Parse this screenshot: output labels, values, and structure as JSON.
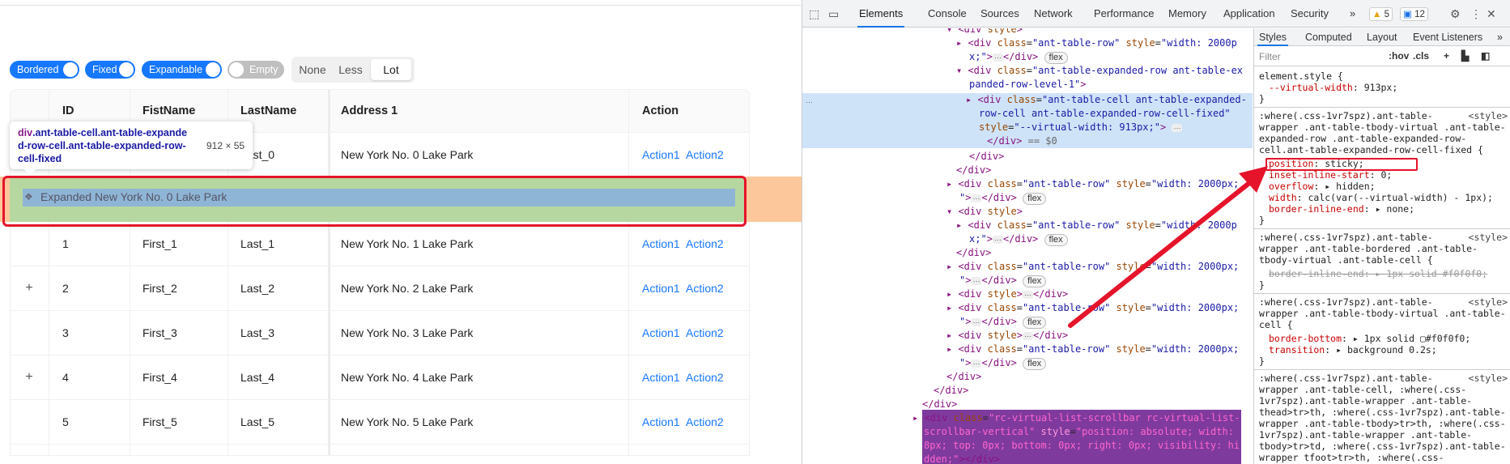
{
  "page": {
    "switches": [
      {
        "label": "Bordered",
        "on": true
      },
      {
        "label": "Fixed",
        "on": true
      },
      {
        "label": "Expandable",
        "on": true
      },
      {
        "label": "Empty",
        "on": false
      }
    ],
    "density": {
      "options": [
        "None",
        "Less",
        "Lot"
      ],
      "selected": "Lot"
    },
    "table": {
      "columns": [
        "ID",
        "FistName",
        "LastName",
        "Address 1",
        "Action"
      ],
      "rows": [
        {
          "expand": "",
          "id": "",
          "first": "",
          "last": "Last_0",
          "addr": "New York No. 0 Lake Park",
          "a1": "Action1",
          "a2": "Action2"
        },
        {
          "expand": "",
          "id": "1",
          "first": "First_1",
          "last": "Last_1",
          "addr": "New York No. 1 Lake Park",
          "a1": "Action1",
          "a2": "Action2"
        },
        {
          "expand": "+",
          "id": "2",
          "first": "First_2",
          "last": "Last_2",
          "addr": "New York No. 2 Lake Park",
          "a1": "Action1",
          "a2": "Action2"
        },
        {
          "expand": "",
          "id": "3",
          "first": "First_3",
          "last": "Last_3",
          "addr": "New York No. 3 Lake Park",
          "a1": "Action1",
          "a2": "Action2"
        },
        {
          "expand": "+",
          "id": "4",
          "first": "First_4",
          "last": "Last_4",
          "addr": "New York No. 4 Lake Park",
          "a1": "Action1",
          "a2": "Action2"
        },
        {
          "expand": "",
          "id": "5",
          "first": "First_5",
          "last": "Last_5",
          "addr": "New York No. 5 Lake Park",
          "a1": "Action1",
          "a2": "Action2"
        }
      ],
      "expanded_text": "Expanded New York No. 0 Lake Park"
    },
    "tooltip": {
      "tag": "div",
      "classes": ".ant-table-cell.ant-table-expanded-row-cell.ant-table-expanded-row-cell-fixed",
      "line1": ".ant-table-cell.ant-table-expande",
      "line2": "d-row-cell.ant-table-expanded-row-",
      "line3": "cell-fixed",
      "size": "912 × 55"
    }
  },
  "devtools": {
    "tabs": [
      "Elements",
      "Console",
      "Sources",
      "Network",
      "Performance",
      "Memory",
      "Application",
      "Security"
    ],
    "active_tab": "Elements",
    "more": "»",
    "warnings": "5",
    "messages": "12",
    "dom_flex": "flex",
    "dom_marker": "== $0",
    "styles_tabs": [
      "Styles",
      "Computed",
      "Layout",
      "Event Listeners"
    ],
    "styles_more": "»",
    "filter_placeholder": "Filter",
    "hov": ":hov",
    "cls": ".cls",
    "source": "<style>",
    "element_style": "element.style {",
    "virtual_width_prop": "--virtual-width",
    "virtual_width_val": "913px;",
    "rule1_selector": [
      ":where(.css-1vr7spz).ant-table-",
      "wrapper .ant-table-tbody-virtual .ant-table-",
      "expanded-row .ant-table-expanded-row-",
      "cell.ant-table-expanded-row-cell-fixed {"
    ],
    "rule1_props": [
      {
        "p": "position",
        "v": "sticky;"
      },
      {
        "p": "inset-inline-start",
        "v": "0;"
      },
      {
        "p": "overflow",
        "v": "▸ hidden;"
      },
      {
        "p": "width",
        "v": "calc(var(--virtual-width) - 1px);"
      },
      {
        "p": "border-inline-end",
        "v": "▸ none;"
      }
    ],
    "rule2_selector": [
      ":where(.css-1vr7spz).ant-table-",
      "wrapper .ant-table-bordered .ant-table-",
      "tbody-virtual .ant-table-cell {"
    ],
    "rule2_prop": "border-inline-end: ▸ 1px solid #f0f0f0;",
    "rule3_selector": [
      ":where(.css-1vr7spz).ant-table-",
      "wrapper .ant-table-tbody-virtual .ant-table-",
      "cell {"
    ],
    "rule3_props": [
      {
        "p": "border-bottom",
        "v": "▸ 1px solid ▢#f0f0f0;"
      },
      {
        "p": "transition",
        "v": "▸ background 0.2s;"
      }
    ],
    "rule4_lines": [
      ":where(.css-1vr7spz).ant-table-",
      "wrapper .ant-table-cell, :where(.css-",
      "1vr7spz).ant-table-wrapper .ant-table-",
      "thead>tr>th, :where(.css-1vr7spz).ant-table-",
      "wrapper .ant-table-tbody>tr>th, :where(.css-",
      "1vr7spz).ant-table-wrapper .ant-table-",
      "tbody>tr>td, :where(.css-1vr7spz).ant-table-",
      "wrapper tfoot>tr>th, :where(.css-"
    ]
  }
}
